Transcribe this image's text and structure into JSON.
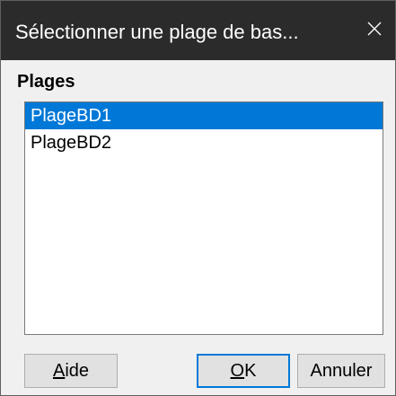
{
  "dialog": {
    "title": "Sélectionner une plage de bas...",
    "close_icon": "close-icon",
    "section_label": "Plages"
  },
  "ranges": {
    "items": [
      {
        "label": "PlageBD1",
        "selected": true
      },
      {
        "label": "PlageBD2",
        "selected": false
      }
    ]
  },
  "buttons": {
    "help": {
      "mnemonic": "A",
      "rest": "ide"
    },
    "ok": {
      "mnemonic": "O",
      "rest": "K"
    },
    "cancel": {
      "label": "Annuler"
    }
  },
  "colors": {
    "titlebar": "#2b2b2b",
    "selection": "#0078d7",
    "dialog_bg": "#f0f0f0"
  }
}
